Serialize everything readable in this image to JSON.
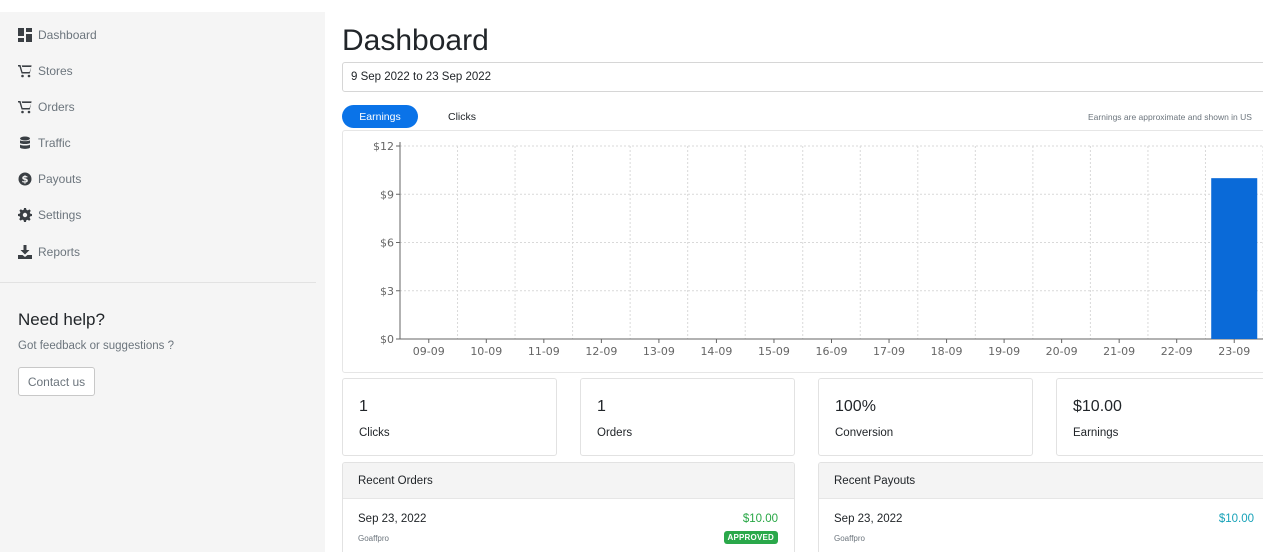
{
  "sidebar": {
    "items": [
      {
        "label": "Dashboard",
        "icon": "dashboard-icon"
      },
      {
        "label": "Stores",
        "icon": "cart-icon"
      },
      {
        "label": "Orders",
        "icon": "cart-icon"
      },
      {
        "label": "Traffic",
        "icon": "database-icon"
      },
      {
        "label": "Payouts",
        "icon": "dollar-circle-icon"
      },
      {
        "label": "Settings",
        "icon": "gear-icon"
      },
      {
        "label": "Reports",
        "icon": "download-icon"
      }
    ],
    "help_title": "Need help?",
    "help_text": "Got feedback or suggestions ?",
    "contact_label": "Contact us"
  },
  "main": {
    "title": "Dashboard",
    "date_range": "9 Sep 2022 to 23 Sep 2022",
    "tabs": [
      {
        "label": "Earnings",
        "active": true
      },
      {
        "label": "Clicks",
        "active": false
      }
    ],
    "earnings_note": "Earnings are approximate and shown in US"
  },
  "chart_data": {
    "type": "bar",
    "categories": [
      "09-09",
      "10-09",
      "11-09",
      "12-09",
      "13-09",
      "14-09",
      "15-09",
      "16-09",
      "17-09",
      "18-09",
      "19-09",
      "20-09",
      "21-09",
      "22-09",
      "23-09"
    ],
    "values": [
      0,
      0,
      0,
      0,
      0,
      0,
      0,
      0,
      0,
      0,
      0,
      0,
      0,
      0,
      10
    ],
    "yticks": [
      0,
      3,
      6,
      9,
      12
    ],
    "ytick_labels": [
      "$0",
      "$3",
      "$6",
      "$9",
      "$12"
    ],
    "ylim": [
      0,
      12
    ],
    "grid": true,
    "bar_color": "#0a6ad8"
  },
  "stats": [
    {
      "value": "1",
      "label": "Clicks"
    },
    {
      "value": "1",
      "label": "Orders"
    },
    {
      "value": "100%",
      "label": "Conversion"
    },
    {
      "value": "$10.00",
      "label": "Earnings"
    }
  ],
  "recent_orders": {
    "title": "Recent Orders",
    "rows": [
      {
        "date": "Sep 23, 2022",
        "store": "Goaffpro",
        "amount": "$10.00",
        "status": "APPROVED"
      }
    ]
  },
  "recent_payouts": {
    "title": "Recent Payouts",
    "rows": [
      {
        "date": "Sep 23, 2022",
        "store": "Goaffpro",
        "amount": "$10.00"
      }
    ]
  },
  "colors": {
    "accent": "#0a73e8",
    "order_amount": "#28a745",
    "payout_amount": "#17a2b8",
    "approved_badge": "#2aa84a"
  }
}
